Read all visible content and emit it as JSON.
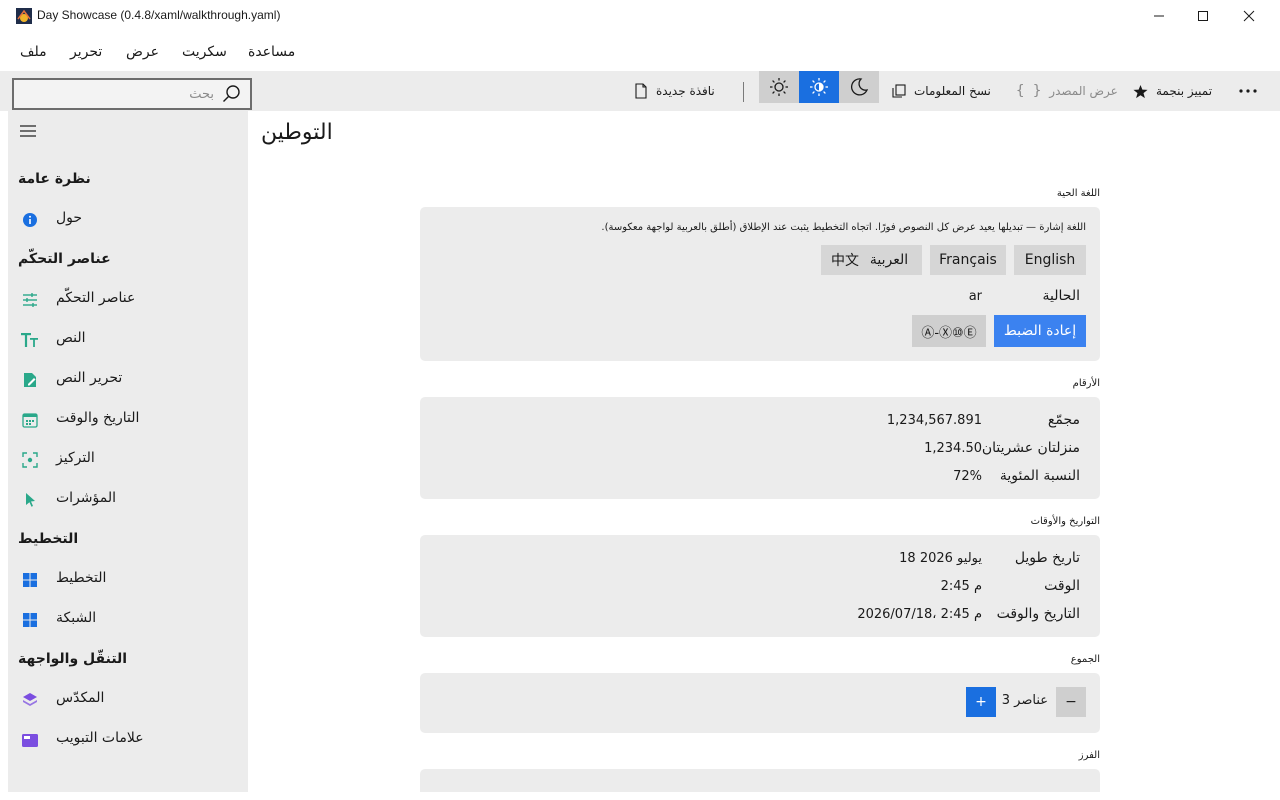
{
  "window": {
    "title": "Day Showcase (0.4.8/xaml/walkthrough.yaml)"
  },
  "menu": {
    "items": [
      "ملف",
      "تحرير",
      "عرض",
      "سكريت",
      "مساعدة"
    ]
  },
  "toolbar": {
    "search_placeholder": "بحث",
    "new_window": "نافذة جديدة",
    "copy_info": "نسخ المعلومات",
    "view_source": "عرض المصدر",
    "star_mark": "تمييز بنجمة"
  },
  "sidebar": {
    "sections": [
      {
        "title": "نظرة عامة",
        "items": [
          {
            "label": "حول",
            "icon": "info-icon"
          }
        ]
      },
      {
        "title": "عناصر التحكّم",
        "items": [
          {
            "label": "عناصر التحكّم",
            "icon": "sliders-icon"
          },
          {
            "label": "النص",
            "icon": "text-icon"
          },
          {
            "label": "تحرير النص",
            "icon": "edit-icon"
          },
          {
            "label": "التاريخ والوقت",
            "icon": "calendar-icon"
          },
          {
            "label": "التركيز",
            "icon": "focus-icon"
          },
          {
            "label": "المؤشرات",
            "icon": "pointer-icon"
          }
        ]
      },
      {
        "title": "التخطيط",
        "items": [
          {
            "label": "التخطيط",
            "icon": "layout-icon"
          },
          {
            "label": "الشبكة",
            "icon": "grid-icon"
          }
        ]
      },
      {
        "title": "التنقّل والواجهة",
        "items": [
          {
            "label": "المكدّس",
            "icon": "stack-icon"
          },
          {
            "label": "علامات التبويب",
            "icon": "tabs-icon"
          }
        ]
      }
    ]
  },
  "main": {
    "title": "التوطين",
    "live_language": {
      "label": "اللغة الحية",
      "note": "اللغة إشارة — تبديلها يعيد عرض كل النصوص فورًا. اتجاه التخطيط يثبت عند الإطلاق (أطلق بالعربية لواجهة معكوسة).",
      "languages": [
        "English",
        "Français",
        "العربية",
        "中文"
      ],
      "current_label": "الحالية",
      "current_value": "ar",
      "reset_label": "إعادة الضبط",
      "pseudo_label": "Ⓐ-Ⓧ⑩Ⓔ"
    },
    "numbers": {
      "label": "الأرقام",
      "rows": [
        {
          "key": "مجمّع",
          "value": "1,234,567.891"
        },
        {
          "key": "منزلتان عشريتان",
          "value": "1,234.50"
        },
        {
          "key": "النسبة المئوية",
          "value": "72%"
        }
      ]
    },
    "datetime": {
      "label": "التواريخ والأوقات",
      "rows": [
        {
          "key": "تاريخ طويل",
          "value": "18 يوليو 2026"
        },
        {
          "key": "الوقت",
          "value": "2:45 م"
        },
        {
          "key": "التاريخ والوقت",
          "value": "2026/07/18، 2:45 م"
        }
      ]
    },
    "plurals": {
      "label": "الجموع",
      "count_text": "3 عناصر",
      "minus": "−",
      "plus": "+"
    },
    "sorting": {
      "label": "الفرز"
    }
  },
  "colors": {
    "accent": "#1a6fe0",
    "sidebar_bg": "#ececec",
    "card_bg": "#ececec"
  }
}
